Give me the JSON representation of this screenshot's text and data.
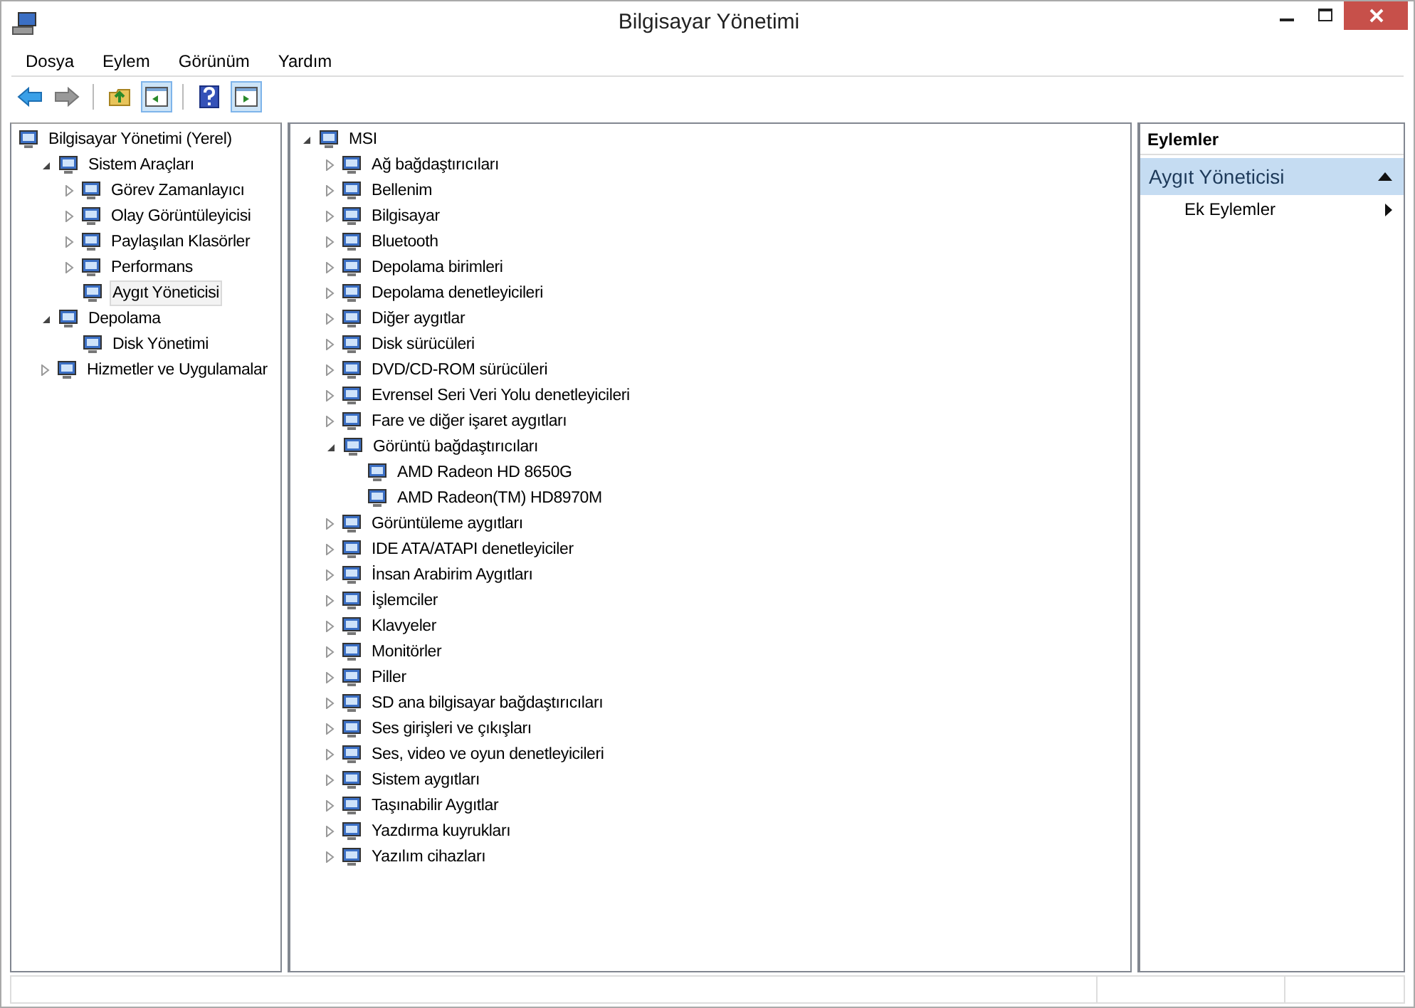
{
  "window": {
    "title": "Bilgisayar Yönetimi"
  },
  "menu": [
    "Dosya",
    "Eylem",
    "Görünüm",
    "Yardım"
  ],
  "toolbar": [
    [
      {
        "kind": "back",
        "pressed": false
      },
      {
        "kind": "forward",
        "pressed": false
      }
    ],
    [
      {
        "kind": "up",
        "pressed": false
      },
      {
        "kind": "tree",
        "pressed": true
      }
    ],
    [
      {
        "kind": "help",
        "pressed": false
      },
      {
        "kind": "pane",
        "pressed": true
      }
    ]
  ],
  "console_tree": [
    {
      "label": "Bilgisayar Yönetimi (Yerel)",
      "kind": "root",
      "selected": false,
      "children": [
        {
          "label": "Sistem Araçları",
          "kind": "branch",
          "expanded": true,
          "selected": false,
          "children": [
            {
              "label": "Görev Zamanlayıcı",
              "kind": "branch",
              "expanded": false,
              "selected": false
            },
            {
              "label": "Olay Görüntüleyicisi",
              "kind": "branch",
              "expanded": false,
              "selected": false
            },
            {
              "label": "Paylaşılan Klasörler",
              "kind": "branch",
              "expanded": false,
              "selected": false
            },
            {
              "label": "Performans",
              "kind": "branch",
              "expanded": false,
              "selected": false
            },
            {
              "label": "Aygıt Yöneticisi",
              "kind": "leaf",
              "selected": true
            }
          ]
        },
        {
          "label": "Depolama",
          "kind": "branch",
          "expanded": true,
          "selected": false,
          "children": [
            {
              "label": "Disk Yönetimi",
              "kind": "leaf",
              "selected": false
            }
          ]
        },
        {
          "label": "Hizmetler ve Uygulamalar",
          "kind": "branch",
          "expanded": false,
          "selected": false
        }
      ]
    }
  ],
  "device_tree": [
    {
      "label": "MSI",
      "kind": "branch",
      "expanded": true,
      "children": [
        {
          "label": "Ağ bağdaştırıcıları",
          "kind": "branch",
          "expanded": false
        },
        {
          "label": "Bellenim",
          "kind": "branch",
          "expanded": false
        },
        {
          "label": "Bilgisayar",
          "kind": "branch",
          "expanded": false
        },
        {
          "label": "Bluetooth",
          "kind": "branch",
          "expanded": false
        },
        {
          "label": "Depolama birimleri",
          "kind": "branch",
          "expanded": false
        },
        {
          "label": "Depolama denetleyicileri",
          "kind": "branch",
          "expanded": false
        },
        {
          "label": "Diğer aygıtlar",
          "kind": "branch",
          "expanded": false
        },
        {
          "label": "Disk sürücüleri",
          "kind": "branch",
          "expanded": false
        },
        {
          "label": "DVD/CD-ROM sürücüleri",
          "kind": "branch",
          "expanded": false
        },
        {
          "label": "Evrensel Seri Veri Yolu denetleyicileri",
          "kind": "branch",
          "expanded": false
        },
        {
          "label": "Fare ve diğer işaret aygıtları",
          "kind": "branch",
          "expanded": false
        },
        {
          "label": "Görüntü bağdaştırıcıları",
          "kind": "branch",
          "expanded": true,
          "children": [
            {
              "label": "AMD Radeon HD 8650G",
              "kind": "leaf"
            },
            {
              "label": "AMD Radeon(TM) HD8970M",
              "kind": "leaf"
            }
          ]
        },
        {
          "label": "Görüntüleme aygıtları",
          "kind": "branch",
          "expanded": false
        },
        {
          "label": "IDE ATA/ATAPI denetleyiciler",
          "kind": "branch",
          "expanded": false
        },
        {
          "label": "İnsan Arabirim Aygıtları",
          "kind": "branch",
          "expanded": false
        },
        {
          "label": "İşlemciler",
          "kind": "branch",
          "expanded": false
        },
        {
          "label": "Klavyeler",
          "kind": "branch",
          "expanded": false
        },
        {
          "label": "Monitörler",
          "kind": "branch",
          "expanded": false
        },
        {
          "label": "Piller",
          "kind": "branch",
          "expanded": false
        },
        {
          "label": "SD ana bilgisayar bağdaştırıcıları",
          "kind": "branch",
          "expanded": false
        },
        {
          "label": "Ses girişleri ve çıkışları",
          "kind": "branch",
          "expanded": false
        },
        {
          "label": "Ses, video ve oyun denetleyicileri",
          "kind": "branch",
          "expanded": false
        },
        {
          "label": "Sistem aygıtları",
          "kind": "branch",
          "expanded": false
        },
        {
          "label": "Taşınabilir Aygıtlar",
          "kind": "branch",
          "expanded": false
        },
        {
          "label": "Yazdırma kuyrukları",
          "kind": "branch",
          "expanded": false
        },
        {
          "label": "Yazılım cihazları",
          "kind": "branch",
          "expanded": false
        }
      ]
    }
  ],
  "actions": {
    "title": "Eylemler",
    "section": {
      "title": "Aygıt Yöneticisi",
      "expanded": true
    },
    "items": [
      {
        "label": "Ek Eylemler"
      }
    ]
  }
}
